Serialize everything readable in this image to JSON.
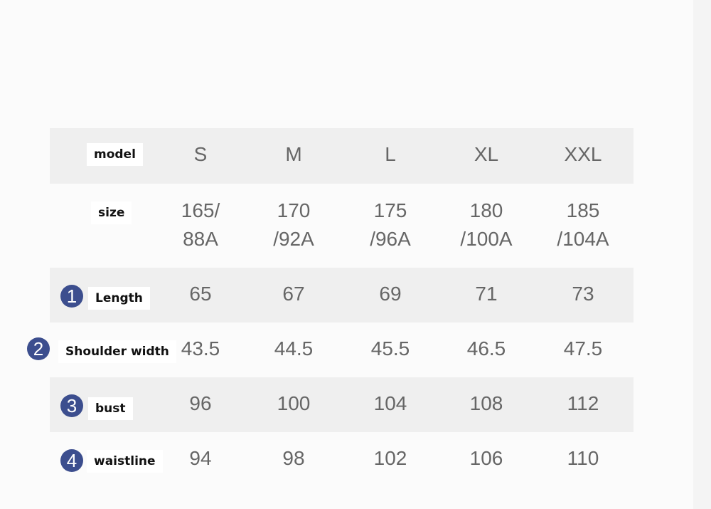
{
  "headers": [
    "S",
    "M",
    "L",
    "XL",
    "XXL"
  ],
  "rows": [
    {
      "label": "model",
      "badge": "",
      "values": [
        "S",
        "M",
        "L",
        "XL",
        "XXL"
      ]
    },
    {
      "label": "size",
      "badge": "",
      "values": [
        "165/\n88A",
        "170\n/92A",
        "175\n/96A",
        "180\n/100A",
        "185\n/104A"
      ]
    },
    {
      "label": "Length",
      "badge": "1",
      "values": [
        "65",
        "67",
        "69",
        "71",
        "73"
      ]
    },
    {
      "label": "Shoulder width",
      "badge": "2",
      "values": [
        "43.5",
        "44.5",
        "45.5",
        "46.5",
        "47.5"
      ]
    },
    {
      "label": "bust",
      "badge": "3",
      "values": [
        "96",
        "100",
        "104",
        "108",
        "112"
      ]
    },
    {
      "label": "waistline",
      "badge": "4",
      "values": [
        "94",
        "98",
        "102",
        "106",
        "110"
      ]
    }
  ],
  "colors": {
    "badge": "#3c4e8e",
    "shade": "#efefef"
  }
}
